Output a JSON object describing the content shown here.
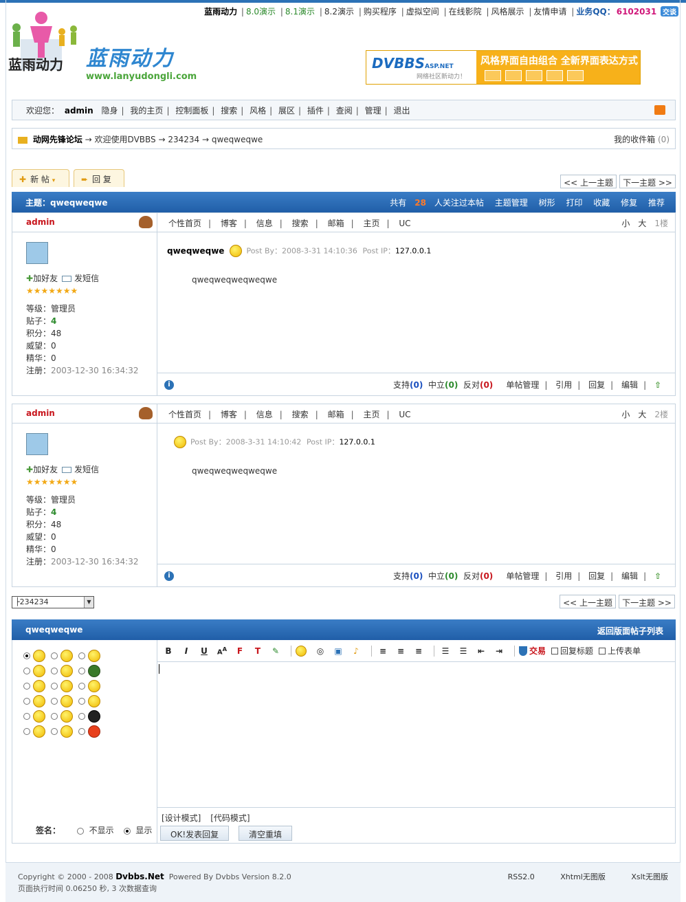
{
  "topnav": {
    "items": [
      "蓝雨动力",
      "8.0演示",
      "8.1演示",
      "8.2演示",
      "购买程序",
      "虚拟空间",
      "在线影院",
      "风格展示",
      "友情申请"
    ],
    "qq_label": "业务QQ：",
    "qq_number": "6102031",
    "qq_badge": "交谈"
  },
  "logo": {
    "cn_text": "蓝雨动力",
    "brand": "蓝雨动力",
    "url": "www.lanyudongli.com"
  },
  "banner": {
    "title": "DVBBS",
    "suffix": "ASP.NET",
    "tagline": "网络社区新动力！",
    "slogan": "风格界面自由组合 全新界面表达方式"
  },
  "userbar": {
    "welcome": "欢迎您：",
    "username": "admin",
    "items": [
      "隐身",
      "我的主页",
      "控制面板",
      "搜索",
      "风格",
      "展区",
      "插件",
      "查阅",
      "管理",
      "退出"
    ]
  },
  "breadcrumb": {
    "forum": "动网先锋论坛",
    "path": "→ 欢迎使用DVBBS → 234234 → qweqweqwe",
    "inbox_label": "我的收件箱",
    "inbox_count": "(0)"
  },
  "buttons": {
    "new_post": "新 帖",
    "reply": "回 复",
    "prev_topic": "<< 上一主题",
    "next_topic": "下一主题 >>"
  },
  "topic_header": {
    "title_prefix": "主题：",
    "title": "qweqweqwe",
    "follow_pre": "共有",
    "follow_count": "28",
    "follow_post": "人关注过本帖",
    "actions": [
      "主题管理",
      "树形",
      "打印",
      "收藏",
      "修复",
      "推荐"
    ]
  },
  "posts": [
    {
      "author": "admin",
      "menu": [
        "个性首页",
        "博客",
        "信息",
        "搜索",
        "邮箱",
        "主页",
        "UC"
      ],
      "size_small": "小",
      "size_big": "大",
      "floor": "1楼",
      "add_friend": "加好友",
      "send_msg": "发短信",
      "stars": "★★★★★★★",
      "level": "等级：管理员",
      "posts_label": "贴子：",
      "posts_count": "4",
      "score": "积分：48",
      "prestige": "威望：0",
      "essence": "精华：0",
      "reg_label": "注册：",
      "reg_date": "2003-12-30 16:34:32",
      "title": "qweqweqwe",
      "post_by": "Post By：2008-3-31 14:10:36",
      "ip_label": "Post IP：",
      "ip": "127.0.0.1",
      "body": "qweqweqweqweqwe",
      "support": "支持",
      "support_n": "(0)",
      "neutral": "中立",
      "neutral_n": "(0)",
      "oppose": "反对",
      "oppose_n": "(0)",
      "manage": "单帖管理",
      "quote": "引用",
      "reply": "回复",
      "edit": "编辑"
    },
    {
      "author": "admin",
      "menu": [
        "个性首页",
        "博客",
        "信息",
        "搜索",
        "邮箱",
        "主页",
        "UC"
      ],
      "size_small": "小",
      "size_big": "大",
      "floor": "2楼",
      "add_friend": "加好友",
      "send_msg": "发短信",
      "stars": "★★★★★★★",
      "level": "等级：管理员",
      "posts_label": "贴子：",
      "posts_count": "4",
      "score": "积分：48",
      "prestige": "威望：0",
      "essence": "精华：0",
      "reg_label": "注册：",
      "reg_date": "2003-12-30 16:34:32",
      "title": "",
      "post_by": "Post By：2008-3-31 14:10:42",
      "ip_label": "Post IP：",
      "ip": "127.0.0.1",
      "body": "qweqweqweqweqwe",
      "support": "支持",
      "support_n": "(0)",
      "neutral": "中立",
      "neutral_n": "(0)",
      "oppose": "反对",
      "oppose_n": "(0)",
      "manage": "单帖管理",
      "quote": "引用",
      "reply": "回复",
      "edit": "编辑"
    }
  ],
  "jump_select": "├234234",
  "reply_box": {
    "title": "qweqweqwe",
    "back": "返回版面帖子列表",
    "trade": "交易",
    "reply_title": "回复标题",
    "upload_form": "上传表单",
    "design_mode": "[设计模式]",
    "code_mode": "[代码模式]",
    "submit": "OK!发表回复",
    "clear": "清空重填",
    "sign_label": "签名：",
    "sign_hide": "不显示",
    "sign_show": "显示"
  },
  "footer": {
    "copyright": "Copyright © 2000 - 2008",
    "brand": "Dvbbs.Net",
    "powered": "Powered By Dvbbs Version 8.2.0",
    "exec_time": "页面执行时间 0.06250 秒, 3 次数据查询",
    "links": [
      "RSS2.0",
      "Xhtml无图版",
      "Xslt无图版"
    ]
  },
  "colors": {
    "accent_blue": "#2c72b6",
    "author_red": "#c8161d",
    "follow_orange": "#ff7a2a"
  }
}
